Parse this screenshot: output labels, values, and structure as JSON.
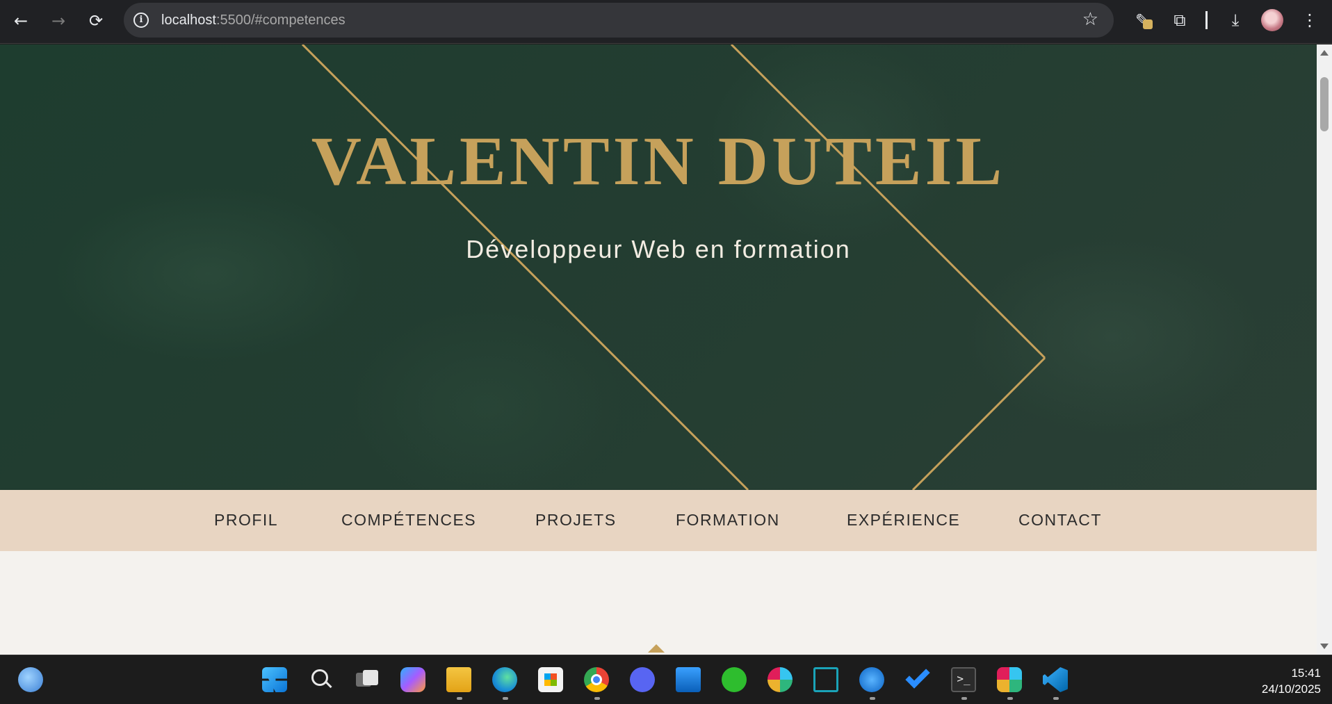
{
  "browser": {
    "url_host": "localhost",
    "url_rest": ":5500/#competences",
    "back_icon": "←",
    "forward_icon": "→",
    "reload_icon": "⟳",
    "star_icon": "☆",
    "download_icon": "⤓",
    "menu_icon": "⋮",
    "extensions_icon": "⧉",
    "pen_icon": "✎"
  },
  "hero": {
    "title": "VALENTIN DUTEIL",
    "subtitle": "Développeur Web en formation",
    "title_color": "#c6a15b",
    "background_color": "#1e3d2f"
  },
  "menu": {
    "background_color": "#e8d5c2",
    "items": [
      {
        "label": "PROFIL"
      },
      {
        "label": "COMPÉTENCES"
      },
      {
        "label": "PROJETS"
      },
      {
        "label": "FORMATION"
      },
      {
        "label": "EXPÉRIENCE"
      },
      {
        "label": "CONTACT"
      }
    ]
  },
  "taskbar": {
    "time": "15:41",
    "date": "24/10/2025",
    "apps": [
      "weather-icon",
      "start-icon",
      "search-icon",
      "task-view-icon",
      "copilot-icon",
      "file-explorer-icon",
      "edge-icon",
      "store-icon",
      "chrome-icon",
      "discord-icon",
      "photos-icon",
      "app-green-icon",
      "slack-icon",
      "visual-paradigm-icon",
      "filezilla-icon",
      "todo-icon",
      "terminal-icon",
      "slack-2-icon",
      "vscode-icon"
    ]
  }
}
